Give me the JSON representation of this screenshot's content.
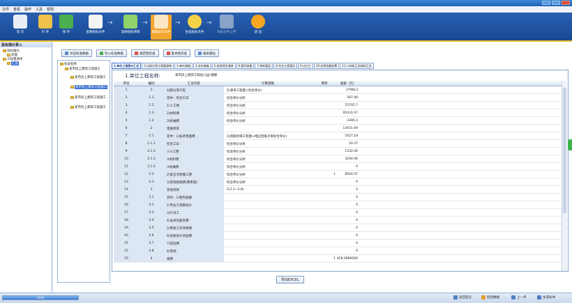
{
  "menu": [
    "文件",
    "查看",
    "操作",
    "工具",
    "帮助"
  ],
  "toolbar": [
    {
      "label": "首 页",
      "icon": "home-icon"
    },
    {
      "label": "打 开",
      "icon": "folder-open-icon"
    },
    {
      "label": "保 存",
      "icon": "save-icon"
    },
    {
      "label": "查看招标文件",
      "icon": "document-view-icon"
    },
    {
      "label": "选择招标项目",
      "icon": "project-select-icon"
    },
    {
      "label": "编辑投标文件",
      "icon": "edit-document-icon"
    },
    {
      "label": "生成投标文件",
      "icon": "generate-file-icon"
    },
    {
      "label": "投标文件上传",
      "icon": "upload-icon"
    },
    {
      "label": "退 出",
      "icon": "exit-icon"
    }
  ],
  "left_pane": {
    "title": "投标报价录入",
    "nodes": [
      "投标报价",
      "封面",
      "工程量清单",
      "汇总"
    ]
  },
  "buttons": [
    {
      "label": "导出标准数据",
      "icon": "export-icon"
    },
    {
      "label": "导入标准数据",
      "icon": "import-icon"
    },
    {
      "label": "规范性检查",
      "icon": "check-icon"
    },
    {
      "label": "基本性检查",
      "icon": "check-icon"
    },
    {
      "label": "报表输出",
      "icon": "report-icon"
    }
  ],
  "tree": {
    "header": "标段名称",
    "items": [
      "某市房上建筑工程施工",
      "某市房上建筑工程施工",
      "某市房上建筑工程施工",
      "某市房上建筑工程施工",
      "某市房上建筑工程施工"
    ]
  },
  "tabs": [
    "1.单位工程报价汇总",
    "2.分部分项工程量清单",
    "3.单价措施",
    "4.总价措施",
    "5.其他项目清单",
    "6.暂列金额",
    "7.材料暂估",
    "8.专业工程暂估",
    "9.计日工",
    "10.总承包服务费",
    "11.人材机汇总材料汇总"
  ],
  "grid": {
    "title": "1.单位工程名称:",
    "title_value": "某市房上建筑工程幼儿园-辅楼",
    "headers": [
      "序号",
      "编码",
      "汇总内容",
      "计算基数",
      "费率",
      "金额（元）"
    ],
    "rows": [
      {
        "seq": "1",
        "code": "1",
        "name": "分部分项工程",
        "base": "Σ(清单工程量×综合单价)",
        "rate": "",
        "amount": "179813"
      },
      {
        "seq": "2",
        "code": "1.1",
        "name": "其中：综合工日",
        "base": "综合单价分析",
        "rate": "",
        "amount": "587.46"
      },
      {
        "seq": "3",
        "code": "1.2",
        "name": "1)人工费",
        "base": "综合单价分析",
        "rate": "",
        "amount": "55705.7"
      },
      {
        "seq": "4",
        "code": "1.3",
        "name": "2)材料费",
        "base": "综合单价分析",
        "rate": "",
        "amount": "95431.67"
      },
      {
        "seq": "5",
        "code": "1.4",
        "name": "3)机械费",
        "base": "综合单价分析",
        "rate": "",
        "amount": "3306.3"
      },
      {
        "seq": "6",
        "code": "2",
        "name": "措施项目",
        "base": "",
        "rate": "",
        "amount": "13931.69"
      },
      {
        "seq": "7",
        "code": "2.1",
        "name": "其中：1)技术措施费",
        "base": "Σ(措施项目工程量×相应措施子目综合单价)",
        "rate": "",
        "amount": "5427.18"
      },
      {
        "seq": "8",
        "code": "2.1.1",
        "name": "综合工日",
        "base": "综合单价分析",
        "rate": "",
        "amount": "20.37"
      },
      {
        "seq": "9",
        "code": "2.1.2",
        "name": "①人工费",
        "base": "综合单价分析",
        "rate": "",
        "amount": "1332.06"
      },
      {
        "seq": "10",
        "code": "2.1.3",
        "name": "②材料费",
        "base": "综合单价分析",
        "rate": "",
        "amount": "3294.96"
      },
      {
        "seq": "11",
        "code": "2.1.4",
        "name": "③机械费",
        "base": "综合单价分析",
        "rate": "",
        "amount": "0"
      },
      {
        "seq": "12",
        "code": "2.2",
        "name": "2)安全文明施工费",
        "base": "综合单价分析",
        "rate": "1",
        "amount": "8504.47"
      },
      {
        "seq": "13",
        "code": "2.3",
        "name": "3)其他措施费(费率类)",
        "base": "综合单价分析",
        "rate": "",
        "amount": "0"
      },
      {
        "seq": "14",
        "code": "3",
        "name": "其他项目",
        "base": "Σ(3.1~3.8)",
        "rate": "",
        "amount": "0"
      },
      {
        "seq": "15",
        "code": "3.1",
        "name": "其中：1)暂列金额",
        "base": "",
        "rate": "",
        "amount": "0"
      },
      {
        "seq": "16",
        "code": "3.2",
        "name": "2)专业工程暂估价",
        "base": "",
        "rate": "",
        "amount": "0"
      },
      {
        "seq": "17",
        "code": "3.3",
        "name": "3)计日工",
        "base": "",
        "rate": "",
        "amount": "0"
      },
      {
        "seq": "18",
        "code": "3.4",
        "name": "4)总承包服务费",
        "base": "",
        "rate": "",
        "amount": "0"
      },
      {
        "seq": "19",
        "code": "3.5",
        "name": "5)零星工作项目费",
        "base": "",
        "rate": "",
        "amount": "0"
      },
      {
        "seq": "20",
        "code": "3.6",
        "name": "6)优质优价奖励费",
        "base": "",
        "rate": "",
        "amount": "0"
      },
      {
        "seq": "21",
        "code": "3.7",
        "name": "7)检验费",
        "base": "",
        "rate": "",
        "amount": "0"
      },
      {
        "seq": "22",
        "code": "3.8",
        "name": "8)其他",
        "base": "",
        "rate": "",
        "amount": "0"
      },
      {
        "seq": "23",
        "code": "4",
        "name": "规费",
        "base": "",
        "rate": "1",
        "amount": "8458.2880000"
      }
    ]
  },
  "export_label": "导出EXCEL",
  "status": {
    "progress_text": "100%",
    "progress_value": 1.0,
    "nav": [
      {
        "label": "返回首页",
        "icon": "home-icon"
      },
      {
        "label": "检验数据",
        "icon": "verify-icon"
      },
      {
        "label": "上一步",
        "icon": "back-icon"
      },
      {
        "label": "生成标书",
        "icon": "generate-icon"
      }
    ]
  }
}
